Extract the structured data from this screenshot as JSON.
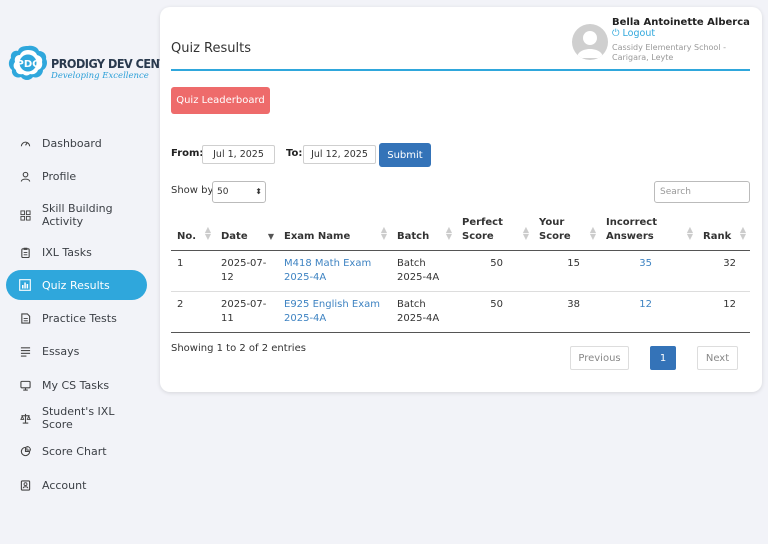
{
  "brand": {
    "badge_letters": "PDC",
    "title": "PRODIGY DEV CENTER",
    "tagline": "Developing Excellence"
  },
  "sidebar": {
    "items": [
      {
        "label": "Dashboard",
        "icon": "speedometer-icon"
      },
      {
        "label": "Profile",
        "icon": "user-icon"
      },
      {
        "label": "Skill Building Activity",
        "icon": "grid-icon"
      },
      {
        "label": "IXL Tasks",
        "icon": "clipboard-icon"
      },
      {
        "label": "Quiz Results",
        "icon": "bar-chart-icon",
        "active": true
      },
      {
        "label": "Practice Tests",
        "icon": "document-icon"
      },
      {
        "label": "Essays",
        "icon": "list-icon"
      },
      {
        "label": "My CS Tasks",
        "icon": "monitor-icon"
      },
      {
        "label": "Student's IXL Score",
        "icon": "balance-icon"
      },
      {
        "label": "Score Chart",
        "icon": "pie-chart-icon"
      },
      {
        "label": "Account",
        "icon": "id-card-icon"
      }
    ]
  },
  "header": {
    "title": "Quiz Results",
    "user_name": "Bella Antoinette Alberca",
    "logout_label": "Logout",
    "school": "Cassidy Elementary School - Carigara, Leyte"
  },
  "actions": {
    "leaderboard_label": "Quiz Leaderboard",
    "submit_label": "Submit"
  },
  "filters": {
    "from_label": "From:",
    "from_value": "Jul 1, 2025",
    "to_label": "To:",
    "to_value": "Jul 12, 2025"
  },
  "table_controls": {
    "show_by_label": "Show by",
    "show_by_value": "50",
    "search_placeholder": "Search"
  },
  "table": {
    "columns": [
      "No.",
      "Date",
      "Exam Name",
      "Batch",
      "Perfect Score",
      "Your Score",
      "Incorrect Answers",
      "Rank"
    ],
    "rows": [
      {
        "no": "1",
        "date": "2025-07-12",
        "exam": "M418 Math Exam 2025-4A",
        "batch": "Batch 2025-4A",
        "perfect": "50",
        "score": "15",
        "incorrect": "35",
        "rank": "32"
      },
      {
        "no": "2",
        "date": "2025-07-11",
        "exam": "E925 English Exam 2025-4A",
        "batch": "Batch 2025-4A",
        "perfect": "50",
        "score": "38",
        "incorrect": "12",
        "rank": "12"
      }
    ]
  },
  "footer": {
    "entries_text": "Showing 1 to 2 of 2 entries",
    "previous_label": "Previous",
    "page_label": "1",
    "next_label": "Next"
  },
  "colors": {
    "accent": "#2fa7dc",
    "danger_button": "#ee6b6b",
    "primary_button": "#3473b8",
    "link": "#3e83c2"
  }
}
